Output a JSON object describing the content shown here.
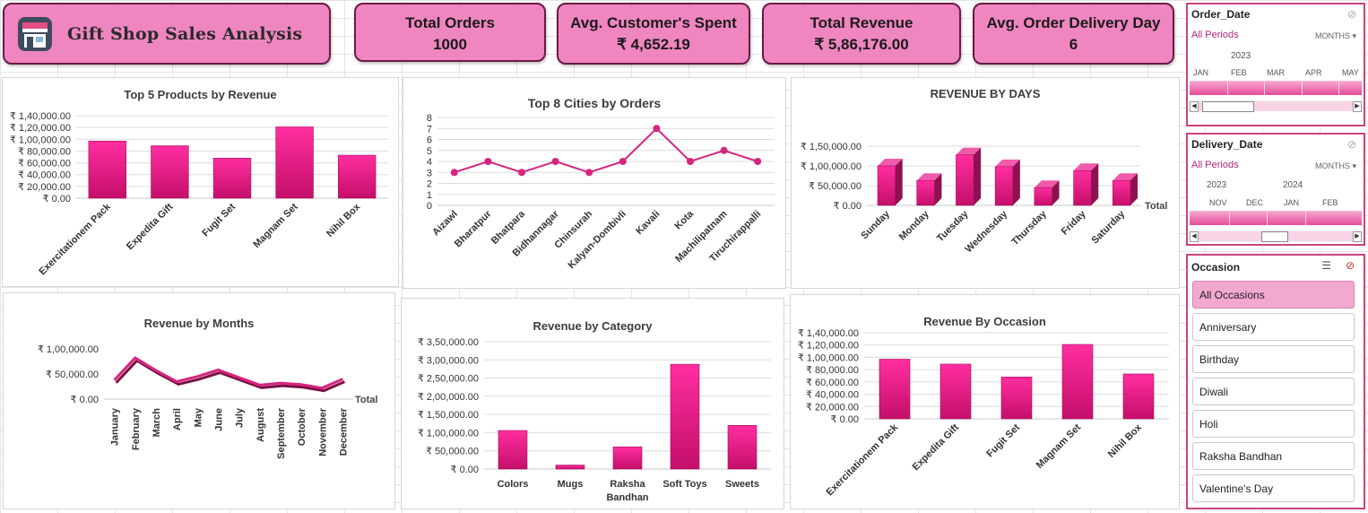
{
  "header": {
    "title": "Gift Shop Sales Analysis"
  },
  "kpis": [
    {
      "label": "Total Orders",
      "value": "1000"
    },
    {
      "label": "Avg. Customer's Spent",
      "value": "₹ 4,652.19"
    },
    {
      "label": "Total Revenue",
      "value": "₹ 5,86,176.00"
    },
    {
      "label": "Avg. Order Delivery Day",
      "value": "6"
    }
  ],
  "colors": {
    "accent": "#ef86c0",
    "bar": "#e11e86",
    "border": "#6b1a45",
    "slicer_border": "#c9447e"
  },
  "slicers": {
    "order_date": {
      "header": "Order_Date",
      "period": "All Periods",
      "level": "MONTHS",
      "years": [
        "2023"
      ],
      "months": [
        "JAN",
        "FEB",
        "MAR",
        "APR",
        "MAY"
      ]
    },
    "delivery_date": {
      "header": "Delivery_Date",
      "period": "All Periods",
      "level": "MONTHS",
      "years": [
        "2023",
        "2024"
      ],
      "months": [
        "NOV",
        "DEC",
        "JAN",
        "FEB"
      ]
    },
    "occasion": {
      "header": "Occasion",
      "items": [
        "All Occasions",
        "Anniversary",
        "Birthday",
        "Diwali",
        "Holi",
        "Raksha Bandhan",
        "Valentine's Day"
      ],
      "selected": "All Occasions"
    }
  },
  "chart_data": [
    {
      "id": "top5",
      "type": "bar",
      "title": "Top 5 Products by Revenue",
      "categories": [
        "Exercitationem Pack",
        "Expedita Gift",
        "Fugit Set",
        "Magnam Set",
        "Nihil Box"
      ],
      "values": [
        97000,
        89000,
        68000,
        121000,
        73000
      ],
      "ylim": [
        0,
        140000
      ],
      "yticks": [
        "₹ 0.00",
        "₹ 20,000.00",
        "₹ 40,000.00",
        "₹ 60,000.00",
        "₹ 80,000.00",
        "₹ 1,00,000.00",
        "₹ 1,20,000.00",
        "₹ 1,40,000.00"
      ]
    },
    {
      "id": "cities",
      "type": "line",
      "title": "Top 8 Cities by Orders",
      "categories": [
        "Aizawl",
        "Bharatpur",
        "Bhatpara",
        "Bidhannagar",
        "Chinsurah",
        "Kalyan-Dombivli",
        "Kavali",
        "Kota",
        "Machilipatnam",
        "Tiruchirappalli"
      ],
      "values": [
        3,
        4,
        3,
        4,
        3,
        4,
        7,
        4,
        5,
        4
      ],
      "ylim": [
        0,
        8
      ],
      "yticks": [
        "0",
        "1",
        "2",
        "3",
        "4",
        "5",
        "6",
        "7",
        "8"
      ]
    },
    {
      "id": "days",
      "type": "bar",
      "title": "REVENUE BY DAYS",
      "categories": [
        "Sunday",
        "Monday",
        "Tuesday",
        "Wednesday",
        "Thursday",
        "Friday",
        "Saturday"
      ],
      "values": [
        100000,
        63000,
        128000,
        98000,
        45000,
        88000,
        63000
      ],
      "ylim": [
        0,
        150000
      ],
      "yticks": [
        "₹ 0.00",
        "₹ 50,000.00",
        "₹ 1,00,000.00",
        "₹ 1,50,000.00"
      ],
      "series_label": "Total"
    },
    {
      "id": "months",
      "type": "line",
      "title": "Revenue by Months",
      "categories": [
        "January",
        "February",
        "March",
        "April",
        "May",
        "June",
        "July",
        "August",
        "September",
        "October",
        "November",
        "December"
      ],
      "values": [
        38000,
        82000,
        57000,
        35000,
        45000,
        58000,
        43000,
        28000,
        32000,
        29000,
        22000,
        40000
      ],
      "ylim": [
        0,
        100000
      ],
      "yticks": [
        "₹ 0.00",
        "₹ 50,000.00",
        "₹ 1,00,000.00"
      ],
      "series_label": "Total"
    },
    {
      "id": "category",
      "type": "bar",
      "title": "Revenue by Category",
      "categories": [
        "Colors",
        "Mugs",
        "Raksha Bandhan",
        "Soft Toys",
        "Sweets"
      ],
      "values": [
        106000,
        11000,
        61000,
        288000,
        120000
      ],
      "ylim": [
        0,
        350000
      ],
      "yticks": [
        "₹ 0.00",
        "₹ 50,000.00",
        "₹ 1,00,000.00",
        "₹ 1,50,000.00",
        "₹ 2,00,000.00",
        "₹ 2,50,000.00",
        "₹ 3,00,000.00",
        "₹ 3,50,000.00"
      ]
    },
    {
      "id": "occasion",
      "type": "bar",
      "title": "Revenue By Occasion",
      "categories": [
        "Exercitationem Pack",
        "Expedita Gift",
        "Fugit Set",
        "Magnam Set",
        "Nihil Box"
      ],
      "values": [
        97000,
        89000,
        68000,
        121000,
        73000
      ],
      "ylim": [
        0,
        140000
      ],
      "yticks": [
        "₹ 0.00",
        "₹ 20,000.00",
        "₹ 40,000.00",
        "₹ 60,000.00",
        "₹ 80,000.00",
        "₹ 1,00,000.00",
        "₹ 1,20,000.00",
        "₹ 1,40,000.00"
      ]
    }
  ]
}
